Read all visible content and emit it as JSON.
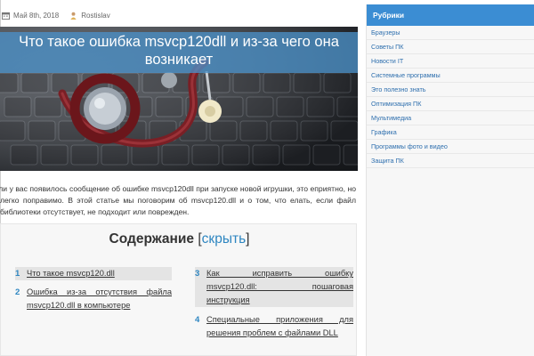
{
  "meta": {
    "date": "Май 8th, 2018",
    "author": "Rostislav"
  },
  "article": {
    "title": "Что такое ошибка msvcp120dll и из-за чего она возникает",
    "intro": "сли у вас появилось сообщение об ошибке msvcp120dll при запуске новой игрушки, это еприятно, но легко поправимо. В этой статье мы поговорим об msvcp120.dll и о том, что елать, если файл библиотеки отсутствует, не подходит или поврежден."
  },
  "toc": {
    "heading": "Содержание",
    "bracket_open": " [",
    "toggle": "скрыть",
    "bracket_close": "]",
    "items": [
      {
        "num": "1",
        "text": "Что такое msvcp120.dll"
      },
      {
        "num": "2",
        "text_line1": "Ошибка из-за отсутствия файла",
        "text_line2": "msvcp120.dll в компьютере"
      },
      {
        "num": "3",
        "text_line1": "Как исправить ошибку",
        "text_line2": "msvcp120.dll: пошаговая",
        "text_line3": "инструкция"
      },
      {
        "num": "4",
        "text_line1": "Специальные приложения для",
        "text_line2": "решения проблем с файлами DLL"
      }
    ]
  },
  "sidebar": {
    "heading": "Рубрики",
    "items": [
      "Браузеры",
      "Советы ПК",
      "Новости IT",
      "Системные программы",
      "Это полезно знать",
      "Оптимизация ПК",
      "Мультимедиа",
      "Графика",
      "Программы фото и видео",
      "Защита ПК"
    ]
  },
  "colors": {
    "accent": "#3b8dd3",
    "link": "#2e86c1",
    "title_band": "#4a90c6"
  },
  "icons": {
    "calendar": "calendar-icon",
    "author": "user-icon"
  }
}
